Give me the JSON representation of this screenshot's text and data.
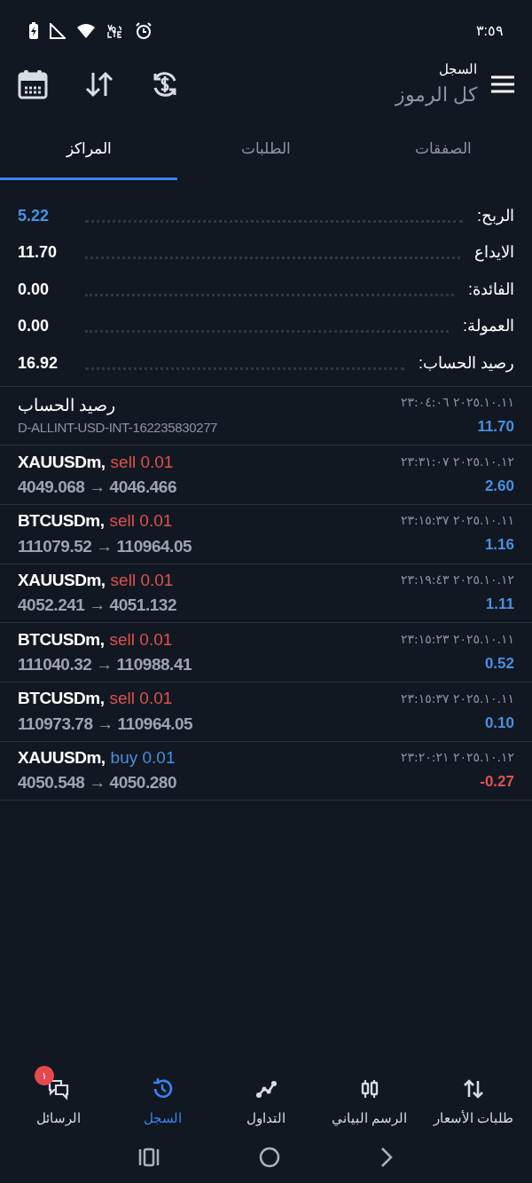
{
  "status_bar": {
    "time": "٣:٥٩"
  },
  "header": {
    "title": "السجل",
    "subtitle": "كل الرموز"
  },
  "tabs": [
    {
      "label": "الصفقات",
      "selected": false
    },
    {
      "label": "الطلبات",
      "selected": false
    },
    {
      "label": "المراكز",
      "selected": true
    }
  ],
  "summary": [
    {
      "label": "الربح:",
      "value": "5.22",
      "highlight": true
    },
    {
      "label": "الايداع",
      "value": "11.70",
      "highlight": false
    },
    {
      "label": "الفائدة:",
      "value": "0.00",
      "highlight": false
    },
    {
      "label": "العمولة:",
      "value": "0.00",
      "highlight": false
    },
    {
      "label": "رصيد الحساب:",
      "value": "16.92",
      "highlight": false
    }
  ],
  "history": [
    {
      "kind": "balance",
      "title": "رصيد الحساب",
      "detail": "D-ALLINT-USD-INT-162235830277",
      "time": "٢٠٢٥.١٠.١١ ٢٣:٠٤:٠٦",
      "amount": "11.70",
      "negative": false
    },
    {
      "kind": "trade",
      "symbol": "XAUUSDm,",
      "order": {
        "text": "sell 0.01",
        "color": "#e05252"
      },
      "prices": "4049.068 → 4046.466",
      "time": "٢٠٢٥.١٠.١٢ ٢٣:٣١:٠٧",
      "amount": "2.60",
      "negative": false
    },
    {
      "kind": "trade",
      "symbol": "BTCUSDm,",
      "order": {
        "text": "sell 0.01",
        "color": "#e05252"
      },
      "prices": "111079.52 → 110964.05",
      "time": "٢٠٢٥.١٠.١١ ٢٣:١٥:٣٧",
      "amount": "1.16",
      "negative": false
    },
    {
      "kind": "trade",
      "symbol": "XAUUSDm,",
      "order": {
        "text": "sell 0.01",
        "color": "#e05252"
      },
      "prices": "4052.241 → 4051.132",
      "time": "٢٠٢٥.١٠.١٢ ٢٣:١٩:٤٣",
      "amount": "1.11",
      "negative": false
    },
    {
      "kind": "trade",
      "symbol": "BTCUSDm,",
      "order": {
        "text": "sell 0.01",
        "color": "#e05252"
      },
      "prices": "111040.32 → 110988.41",
      "time": "٢٠٢٥.١٠.١١ ٢٣:١٥:٢٣",
      "amount": "0.52",
      "negative": false
    },
    {
      "kind": "trade",
      "symbol": "BTCUSDm,",
      "order": {
        "text": "sell 0.01",
        "color": "#e05252"
      },
      "prices": "110973.78 → 110964.05",
      "time": "٢٠٢٥.١٠.١١ ٢٣:١٥:٣٧",
      "amount": "0.10",
      "negative": false
    },
    {
      "kind": "trade",
      "symbol": "XAUUSDm,",
      "order": {
        "text": "buy 0.01",
        "color": "#4a90e2"
      },
      "prices": "4050.548 → 4050.280",
      "time": "٢٠٢٥.١٠.١٢ ٢٣:٢٠:٢١",
      "amount": "-0.27",
      "negative": true
    }
  ],
  "bottom_nav": [
    {
      "kind": "quotes",
      "label": "طلبات الأسعار",
      "selected": false
    },
    {
      "kind": "chart",
      "label": "الرسم البياني",
      "selected": false
    },
    {
      "kind": "trade",
      "label": "التداول",
      "selected": false
    },
    {
      "kind": "history",
      "label": "السجل",
      "selected": true
    },
    {
      "kind": "messages",
      "label": "الرسائل",
      "selected": false,
      "badge": "١"
    }
  ]
}
